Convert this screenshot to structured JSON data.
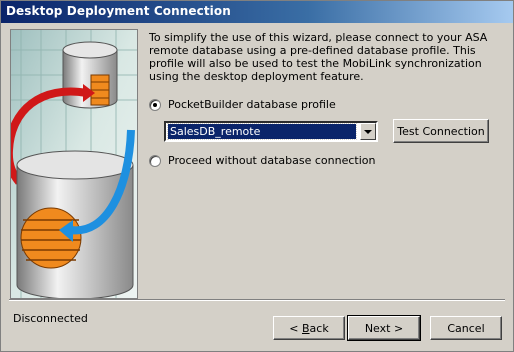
{
  "window": {
    "title": "Desktop Deployment Connection"
  },
  "intro_text": "To simplify the use of this wizard, please connect to your ASA remote database using a pre-defined database profile.  This profile will also be used to test the MobiLink synchronization using the desktop deployment feature.",
  "options": {
    "profile_option": {
      "label": "PocketBuilder database profile",
      "selected": true
    },
    "no_connection_option": {
      "label": "Proceed without database connection",
      "selected": false
    }
  },
  "profile_select": {
    "value": "SalesDB_remote"
  },
  "buttons": {
    "test_connection": "Test Connection",
    "back_prefix": "< ",
    "back_underlined": "B",
    "back_rest": "ack",
    "next": "Next >",
    "cancel": "Cancel"
  },
  "status": "Disconnected",
  "colors": {
    "titlebar_start": "#0a246a",
    "titlebar_end": "#a6caf0",
    "dialog_bg": "#d4d0c8",
    "selection": "#0a246a"
  },
  "icons": [
    "database-cylinder-icon",
    "sync-arrow-icon",
    "dropdown-arrow-icon"
  ]
}
